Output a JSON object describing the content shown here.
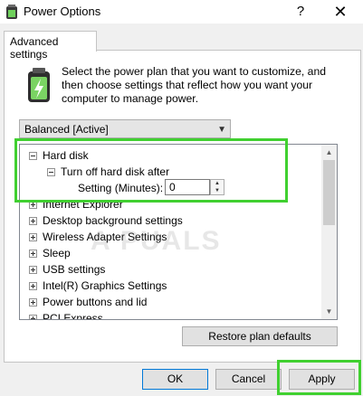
{
  "window": {
    "title": "Power Options",
    "help": "?",
    "close": "✕"
  },
  "tab": {
    "label": "Advanced settings"
  },
  "description": "Select the power plan that you want to customize, and then choose settings that reflect how you want your computer to manage power.",
  "plan_select": {
    "value": "Balanced [Active]"
  },
  "tree": {
    "items": [
      {
        "label": "Hard disk",
        "expanded": true
      },
      {
        "label": "Turn off hard disk after",
        "expanded": true
      },
      {
        "label": "Setting (Minutes):",
        "value": "0"
      },
      {
        "label": "Internet Explorer"
      },
      {
        "label": "Desktop background settings"
      },
      {
        "label": "Wireless Adapter Settings"
      },
      {
        "label": "Sleep"
      },
      {
        "label": "USB settings"
      },
      {
        "label": "Intel(R) Graphics Settings"
      },
      {
        "label": "Power buttons and lid"
      },
      {
        "label": "PCI Express"
      }
    ]
  },
  "buttons": {
    "restore": "Restore plan defaults",
    "ok": "OK",
    "cancel": "Cancel",
    "apply": "Apply"
  },
  "watermark": "A PUALS",
  "colors": {
    "highlight": "#40d030",
    "accent": "#0078d7"
  }
}
